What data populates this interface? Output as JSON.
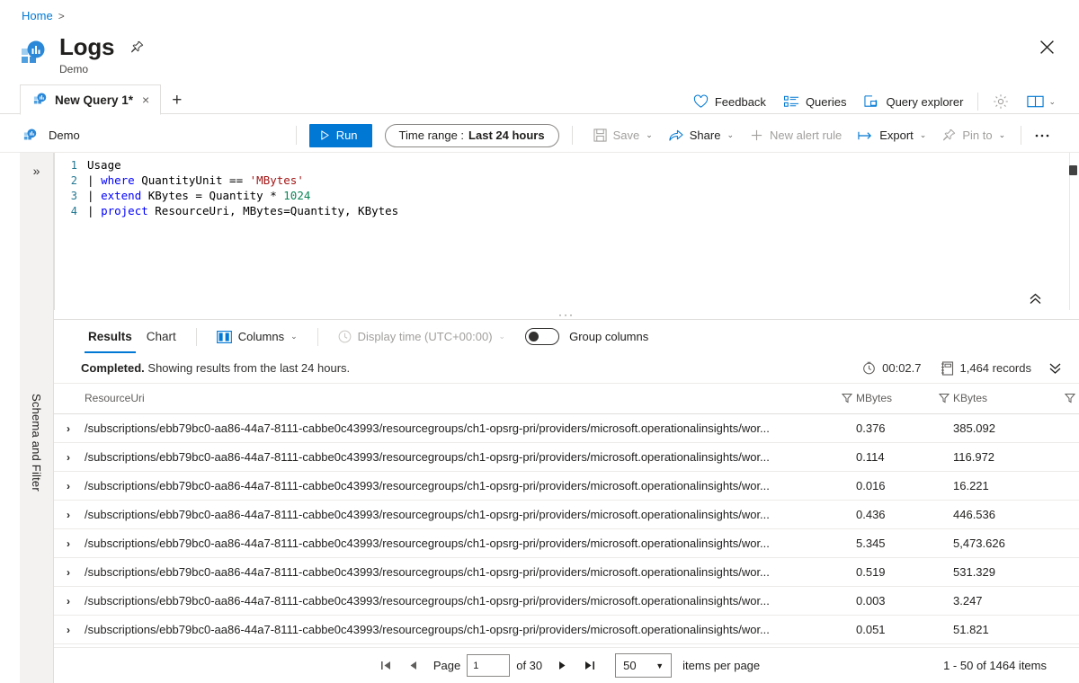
{
  "breadcrumb": {
    "home": "Home",
    "separator": ">"
  },
  "header": {
    "title": "Logs",
    "subtitle": "Demo",
    "pin_icon": "pin-icon",
    "more_icon": "ellipsis-icon",
    "close_icon": "close-icon"
  },
  "tabs": {
    "items": [
      {
        "label": "New Query 1*",
        "close": "×"
      }
    ],
    "add_label": "+"
  },
  "topbar": {
    "feedback": "Feedback",
    "queries": "Queries",
    "query_explorer": "Query explorer",
    "settings_icon": "gear-icon",
    "help_icon": "book-icon",
    "help_chevron": "⌄"
  },
  "commandbar": {
    "scope": "Demo",
    "run": "Run",
    "time_range_label": "Time range :",
    "time_range_value": "Last 24 hours",
    "save": "Save",
    "share": "Share",
    "new_alert_rule": "New alert rule",
    "export": "Export",
    "pin_to": "Pin to",
    "more": "···"
  },
  "leftrail": {
    "expand_icon": "double-chevron-right-icon",
    "label": "Schema and Filter"
  },
  "editor": {
    "lines": [
      {
        "num": "1",
        "segments": [
          {
            "t": "Usage",
            "c": "plain"
          }
        ]
      },
      {
        "num": "2",
        "segments": [
          {
            "t": "| ",
            "c": "pipe"
          },
          {
            "t": "where",
            "c": "kw"
          },
          {
            "t": " QuantityUnit == ",
            "c": "plain"
          },
          {
            "t": "'MBytes'",
            "c": "str"
          }
        ]
      },
      {
        "num": "3",
        "segments": [
          {
            "t": "| ",
            "c": "pipe"
          },
          {
            "t": "extend",
            "c": "kw"
          },
          {
            "t": " KBytes = Quantity * ",
            "c": "plain"
          },
          {
            "t": "1024",
            "c": "num"
          }
        ]
      },
      {
        "num": "4",
        "segments": [
          {
            "t": "| ",
            "c": "pipe"
          },
          {
            "t": "project",
            "c": "kw"
          },
          {
            "t": " ResourceUri, MBytes=Quantity, KBytes",
            "c": "plain"
          }
        ]
      }
    ],
    "collapse_icon": "double-chevron-up-icon"
  },
  "results_header": {
    "tab_results": "Results",
    "tab_chart": "Chart",
    "columns": "Columns",
    "display_time": "Display time (UTC+00:00)",
    "group_columns": "Group columns",
    "group_columns_on": false
  },
  "status": {
    "completed": "Completed.",
    "message": " Showing results from the last 24 hours.",
    "duration": "00:02.7",
    "records": "1,464 records",
    "collapse_icon": "double-chevron-down-icon"
  },
  "table": {
    "columns": [
      {
        "key": "ResourceUri",
        "label": "ResourceUri"
      },
      {
        "key": "MBytes",
        "label": "MBytes"
      },
      {
        "key": "KBytes",
        "label": "KBytes"
      }
    ],
    "rows": [
      {
        "uri": "/subscriptions/ebb79bc0-aa86-44a7-8111-cabbe0c43993/resourcegroups/ch1-opsrg-pri/providers/microsoft.operationalinsights/wor...",
        "mbytes": "0.376",
        "kbytes": "385.092"
      },
      {
        "uri": "/subscriptions/ebb79bc0-aa86-44a7-8111-cabbe0c43993/resourcegroups/ch1-opsrg-pri/providers/microsoft.operationalinsights/wor...",
        "mbytes": "0.114",
        "kbytes": "116.972"
      },
      {
        "uri": "/subscriptions/ebb79bc0-aa86-44a7-8111-cabbe0c43993/resourcegroups/ch1-opsrg-pri/providers/microsoft.operationalinsights/wor...",
        "mbytes": "0.016",
        "kbytes": "16.221"
      },
      {
        "uri": "/subscriptions/ebb79bc0-aa86-44a7-8111-cabbe0c43993/resourcegroups/ch1-opsrg-pri/providers/microsoft.operationalinsights/wor...",
        "mbytes": "0.436",
        "kbytes": "446.536"
      },
      {
        "uri": "/subscriptions/ebb79bc0-aa86-44a7-8111-cabbe0c43993/resourcegroups/ch1-opsrg-pri/providers/microsoft.operationalinsights/wor...",
        "mbytes": "5.345",
        "kbytes": "5,473.626"
      },
      {
        "uri": "/subscriptions/ebb79bc0-aa86-44a7-8111-cabbe0c43993/resourcegroups/ch1-opsrg-pri/providers/microsoft.operationalinsights/wor...",
        "mbytes": "0.519",
        "kbytes": "531.329"
      },
      {
        "uri": "/subscriptions/ebb79bc0-aa86-44a7-8111-cabbe0c43993/resourcegroups/ch1-opsrg-pri/providers/microsoft.operationalinsights/wor...",
        "mbytes": "0.003",
        "kbytes": "3.247"
      },
      {
        "uri": "/subscriptions/ebb79bc0-aa86-44a7-8111-cabbe0c43993/resourcegroups/ch1-opsrg-pri/providers/microsoft.operationalinsights/wor...",
        "mbytes": "0.051",
        "kbytes": "51.821"
      }
    ]
  },
  "pager": {
    "page_label": "Page",
    "page_value": "1",
    "of_pages": "of 30",
    "page_size": "50",
    "items_per_page": "items per page",
    "range": "1 - 50 of 1464 items"
  },
  "colors": {
    "accent": "#0078d4",
    "keyword": "#0000ff",
    "string": "#a31515",
    "number": "#098658",
    "linenumber": "#237893"
  }
}
